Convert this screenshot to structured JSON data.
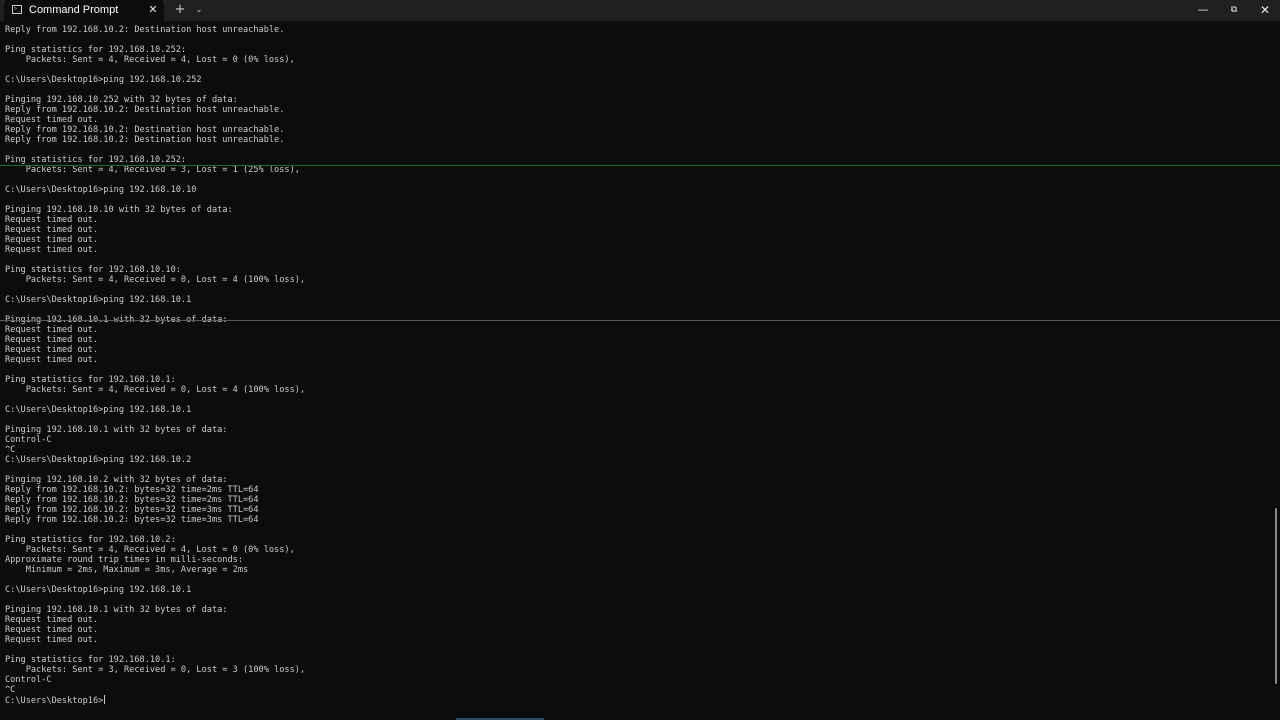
{
  "window": {
    "tab_title": "Command Prompt",
    "tab_icon": "cmd-icon",
    "new_tab_label": "+",
    "dropdown_label": "⌄",
    "tab_close_label": "✕",
    "minimize_label": "—",
    "restore_label": "⧉",
    "close_label": "✕"
  },
  "terminal": {
    "lines": [
      "Reply from 192.168.10.2: Destination host unreachable.",
      "",
      "Ping statistics for 192.168.10.252:",
      "    Packets: Sent = 4, Received = 4, Lost = 0 (0% loss),",
      "",
      "C:\\Users\\Desktop16>ping 192.168.10.252",
      "",
      "Pinging 192.168.10.252 with 32 bytes of data:",
      "Reply from 192.168.10.2: Destination host unreachable.",
      "Request timed out.",
      "Reply from 192.168.10.2: Destination host unreachable.",
      "Reply from 192.168.10.2: Destination host unreachable.",
      "",
      "Ping statistics for 192.168.10.252:",
      "    Packets: Sent = 4, Received = 3, Lost = 1 (25% loss),",
      "",
      "C:\\Users\\Desktop16>ping 192.168.10.10",
      "",
      "Pinging 192.168.10.10 with 32 bytes of data:",
      "Request timed out.",
      "Request timed out.",
      "Request timed out.",
      "Request timed out.",
      "",
      "Ping statistics for 192.168.10.10:",
      "    Packets: Sent = 4, Received = 0, Lost = 4 (100% loss),",
      "",
      "C:\\Users\\Desktop16>ping 192.168.10.1",
      "",
      "Pinging 192.168.10.1 with 32 bytes of data:",
      "Request timed out.",
      "Request timed out.",
      "Request timed out.",
      "Request timed out.",
      "",
      "Ping statistics for 192.168.10.1:",
      "    Packets: Sent = 4, Received = 0, Lost = 4 (100% loss),",
      "",
      "C:\\Users\\Desktop16>ping 192.168.10.1",
      "",
      "Pinging 192.168.10.1 with 32 bytes of data:",
      "Control-C",
      "^C",
      "C:\\Users\\Desktop16>ping 192.168.10.2",
      "",
      "Pinging 192.168.10.2 with 32 bytes of data:",
      "Reply from 192.168.10.2: bytes=32 time=2ms TTL=64",
      "Reply from 192.168.10.2: bytes=32 time=2ms TTL=64",
      "Reply from 192.168.10.2: bytes=32 time=3ms TTL=64",
      "Reply from 192.168.10.2: bytes=32 time=3ms TTL=64",
      "",
      "Ping statistics for 192.168.10.2:",
      "    Packets: Sent = 4, Received = 4, Lost = 0 (0% loss),",
      "Approximate round trip times in milli-seconds:",
      "    Minimum = 2ms, Maximum = 3ms, Average = 2ms",
      "",
      "C:\\Users\\Desktop16>ping 192.168.10.1",
      "",
      "Pinging 192.168.10.1 with 32 bytes of data:",
      "Request timed out.",
      "Request timed out.",
      "Request timed out.",
      "",
      "Ping statistics for 192.168.10.1:",
      "    Packets: Sent = 3, Received = 0, Lost = 3 (100% loss),",
      "Control-C",
      "^C",
      "C:\\Users\\Desktop16>"
    ]
  },
  "colors": {
    "background": "#0c0c0c",
    "text": "#cccccc",
    "titlebar": "#202020"
  }
}
